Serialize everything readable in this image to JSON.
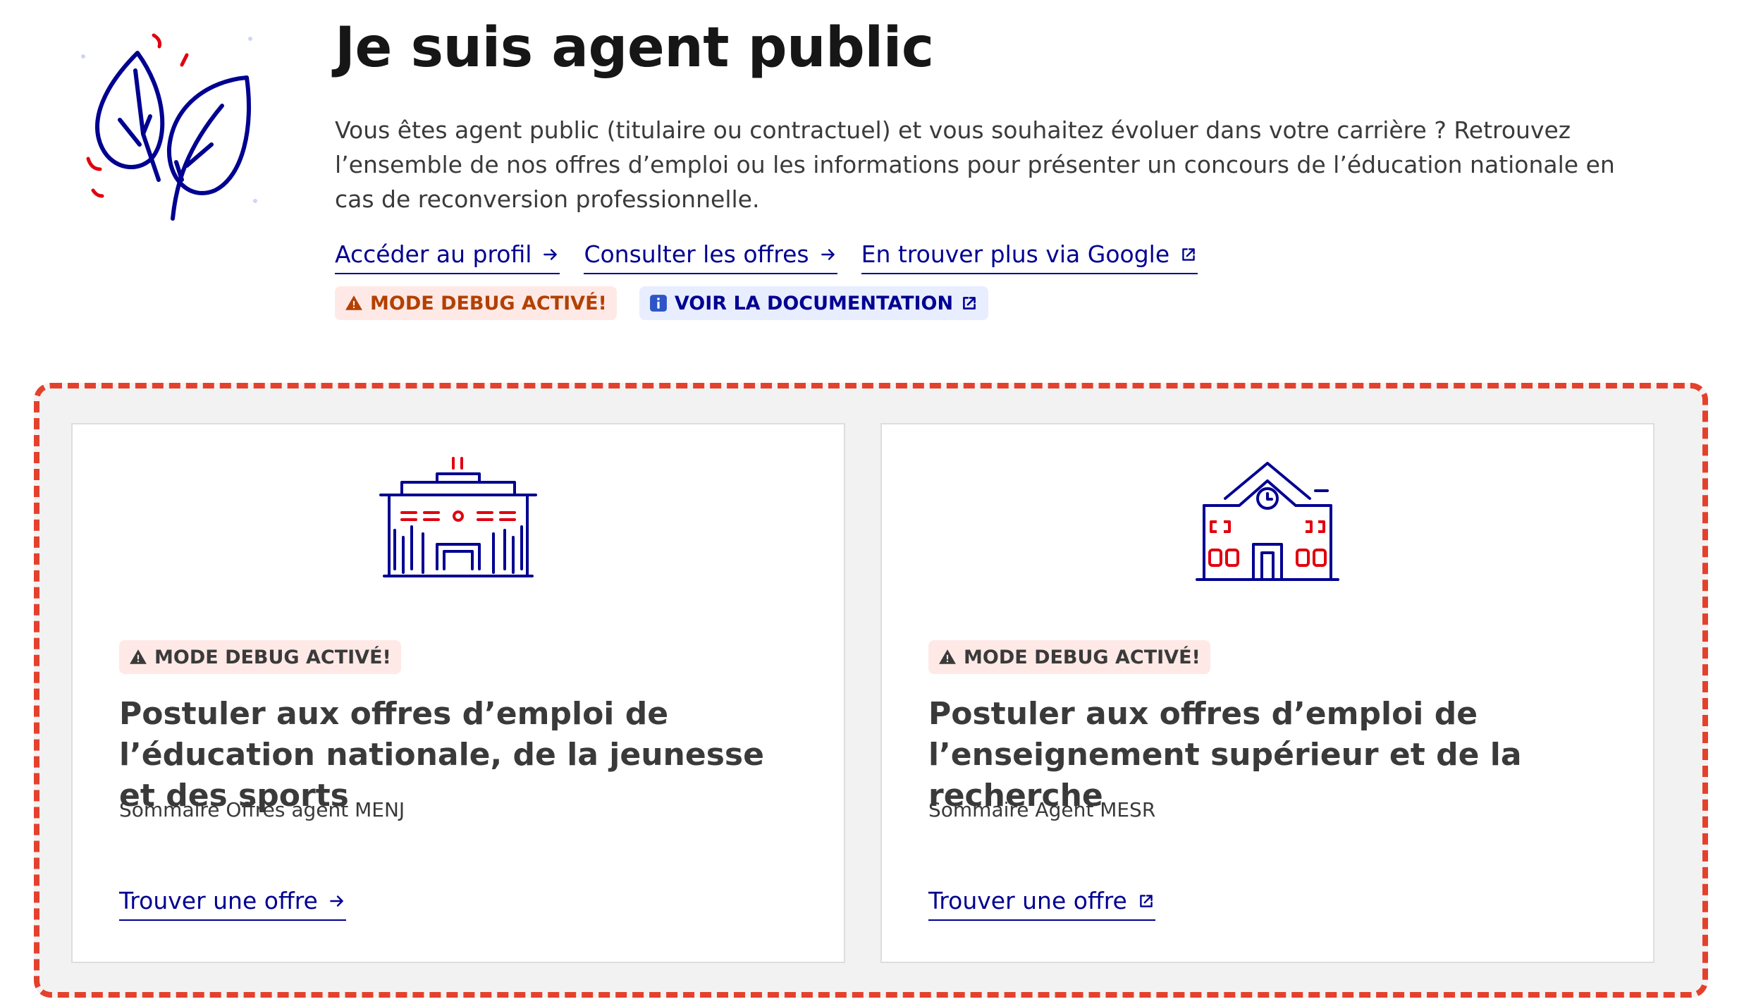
{
  "hero": {
    "title": "Je suis agent public",
    "lead": "Vous êtes agent public (titulaire ou contractuel) et vous souhaitez évoluer dans votre carrière ? Retrouvez l’ensemble de nos offres d’emploi ou les informations pour présenter un concours de l’éducation nationale en cas de reconversion professionnelle.",
    "links": [
      {
        "label": "Accéder au profil",
        "icon": "arrow-right-icon"
      },
      {
        "label": "Consulter les offres",
        "icon": "arrow-right-icon"
      },
      {
        "label": "En trouver plus via Google",
        "icon": "external-link-icon"
      }
    ],
    "debug_badge": "Mode debug activé!",
    "doc_badge": "Voir la documentation"
  },
  "cards": [
    {
      "badge": "Mode debug activé!",
      "title": "Postuler aux offres d’emploi de l’éducation nationale, de la jeunesse et des sports",
      "desc": "Sommaire Offres agent MENJ",
      "link": "Trouver une offre",
      "link_icon": "arrow-right-icon",
      "illustration": "government-building-icon"
    },
    {
      "badge": "Mode debug activé!",
      "title": "Postuler aux offres d’emploi de l’enseignement supérieur et de la recherche",
      "desc": "Sommaire Agent MESR",
      "link": "Trouver une offre",
      "link_icon": "external-link-icon",
      "illustration": "school-building-icon"
    }
  ],
  "colors": {
    "primary": "#000091",
    "accent_red": "#e1000f",
    "debug_frame": "#e4412d",
    "warning_text": "#b34000",
    "warning_bg": "#ffe9e6",
    "info_bg": "#e8edff"
  }
}
